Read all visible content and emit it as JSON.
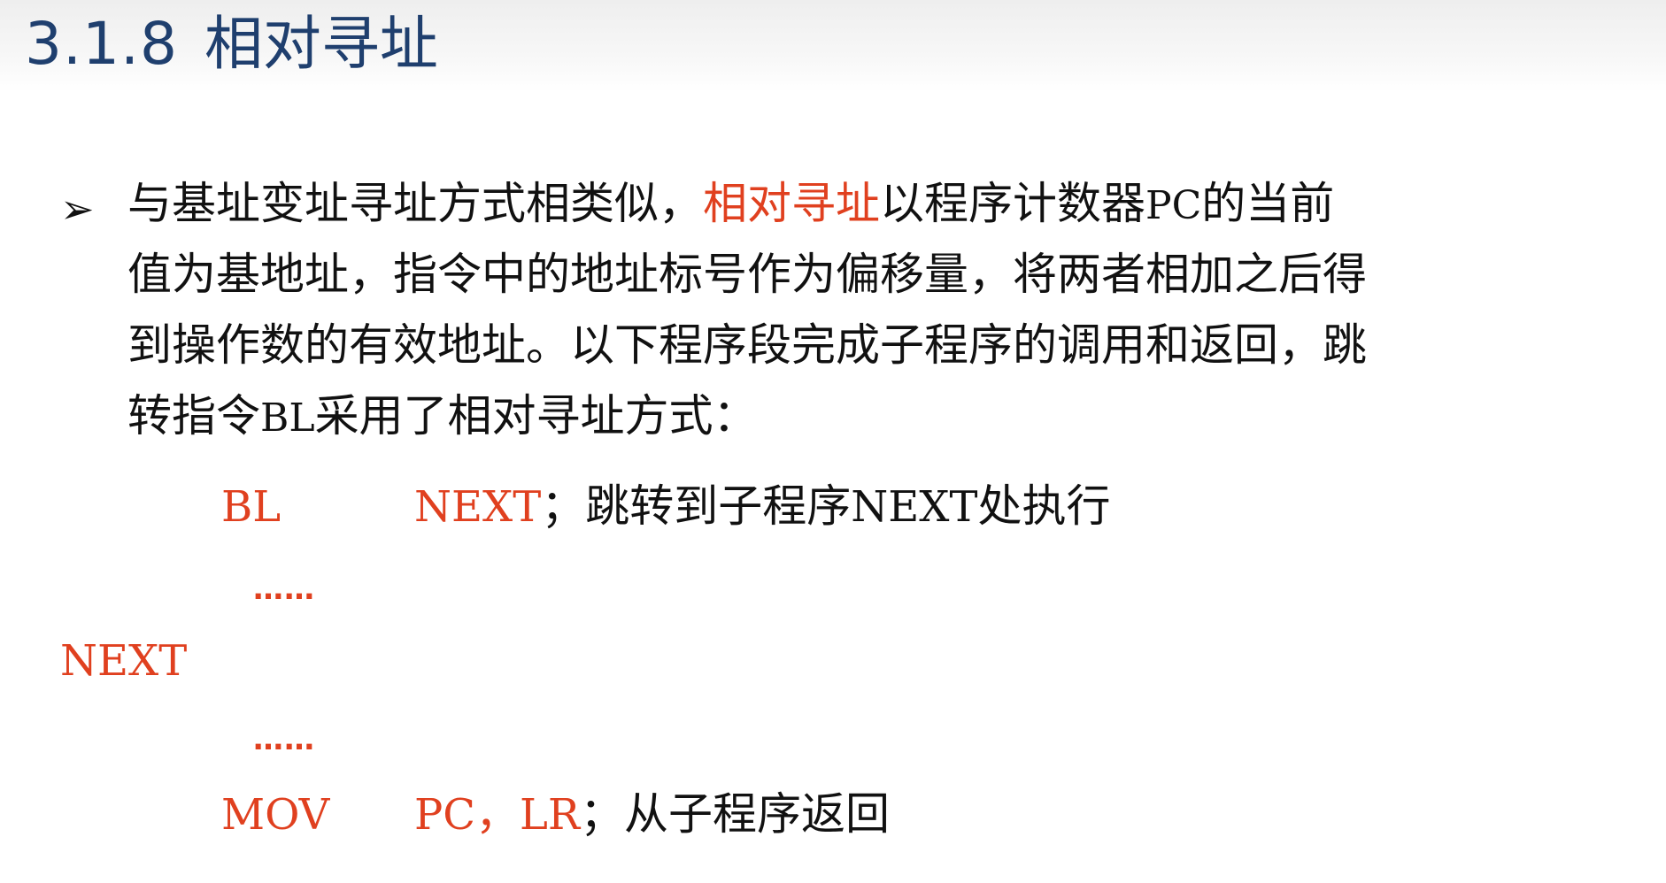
{
  "header": {
    "section_number": "3.1.8",
    "section_title": "相对寻址"
  },
  "bullet": {
    "symbol": "➢",
    "line1_a": "与基址变址寻址方式相类似，",
    "line1_highlight": "相对寻址",
    "line1_b": "以程序计数器",
    "line1_pc": "PC",
    "line1_c": "的当前",
    "line2": "值为基地址，指令中的地址标号作为偏移量，将两者相加之后得",
    "line3": "到操作数的有效地址。以下程序段完成子程序的调用和返回，跳",
    "line4_a": "转指令",
    "line4_bl": "BL",
    "line4_b": "采用了相对寻址方式："
  },
  "code": {
    "line1_op": "BL",
    "line1_arg": "NEXT",
    "line1_sep": "；",
    "line1_comment_a": "跳转到子程序",
    "line1_comment_label": "NEXT",
    "line1_comment_b": "处执行",
    "dots1": "……",
    "label": "NEXT",
    "dots2": "……",
    "line2_op": "MOV",
    "line2_arg1": "PC",
    "line2_comma": "，",
    "line2_arg2": "LR",
    "line2_sep": "；",
    "line2_comment": "从子程序返回"
  },
  "colors": {
    "title": "#1f3f6e",
    "highlight": "#e0401f",
    "text": "#111111"
  }
}
